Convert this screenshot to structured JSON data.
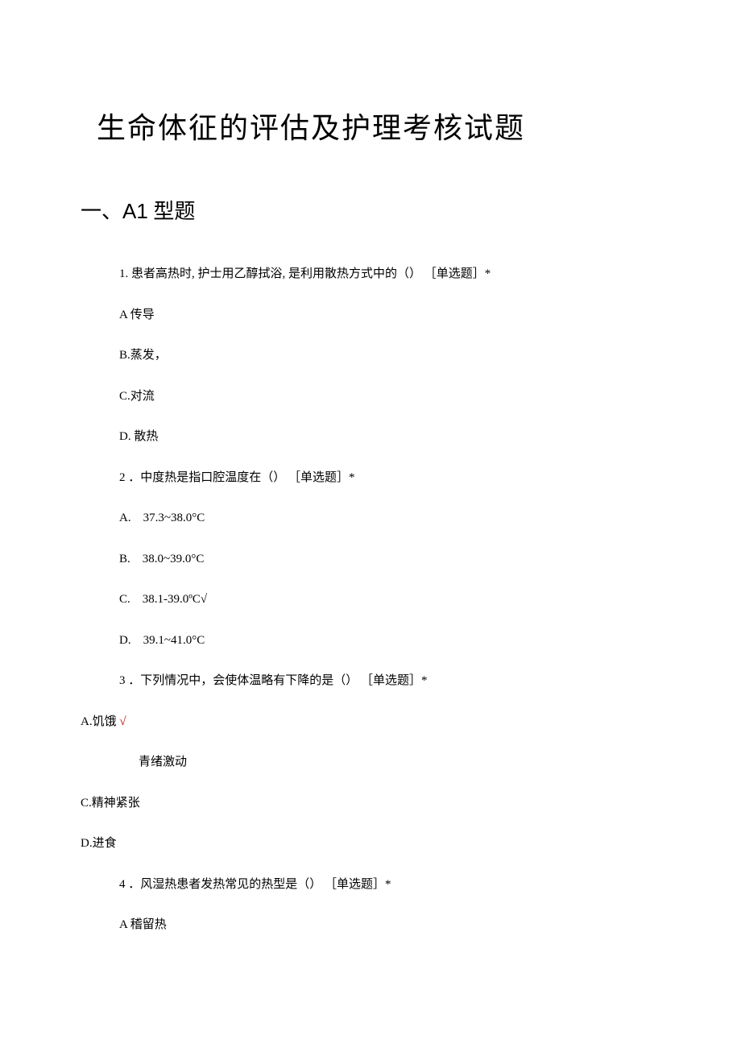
{
  "title": "生命体征的评估及护理考核试题",
  "sectionHeader": {
    "prefix": "一、",
    "type": "A1",
    "suffix": " 型题"
  },
  "q1": {
    "text": "1. 患者高热时, 护士用乙醇拭浴, 是利用散热方式中的（） ［单选题］*",
    "a": "A 传导",
    "b": "B.蒸发，",
    "c": "C.对流",
    "d": "D. 散热"
  },
  "q2": {
    "text": "2 ．中度热是指口腔温度在（） ［单选题］*",
    "a": "A.　37.3~38.0°C",
    "b": "B.　38.0~39.0°C",
    "c": "C.　38.1-39.0ºC√",
    "d": "D.　39.1~41.0°C"
  },
  "q3": {
    "text": "3 ．下列情况中，会使体温略有下降的是（） ［单选题］*",
    "a": "A.饥饿 ",
    "aCheck": "√",
    "b": "青绪激动",
    "c": "C.精神紧张",
    "d": "D.进食"
  },
  "q4": {
    "text": "4 ．风湿热患者发热常见的热型是（） ［单选题］*",
    "a": "A 稽留热"
  }
}
